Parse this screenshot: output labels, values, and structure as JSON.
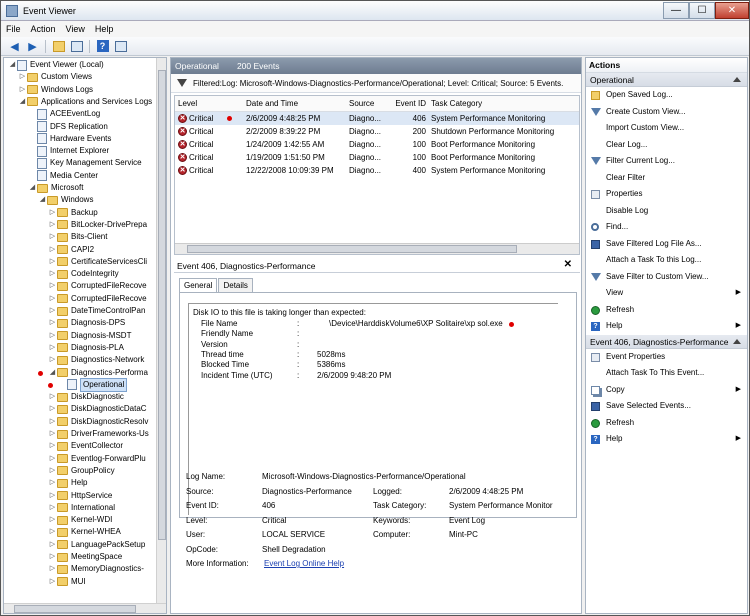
{
  "window": {
    "title": "Event Viewer",
    "min": "—",
    "max": "☐",
    "close": "✕"
  },
  "menu": [
    "File",
    "Action",
    "View",
    "Help"
  ],
  "toolbar": {
    "back": "◀",
    "forward": "▶",
    "help": "?"
  },
  "tree": [
    {
      "label": "Event Viewer (Local)",
      "depth": 0,
      "expanded": true,
      "icon": "viewer-icon"
    },
    {
      "label": "Custom Views",
      "depth": 1,
      "expanded": false,
      "icon": "folder-icon"
    },
    {
      "label": "Windows Logs",
      "depth": 1,
      "expanded": false,
      "icon": "folder-icon"
    },
    {
      "label": "Applications and Services Logs",
      "depth": 1,
      "expanded": true,
      "icon": "folder-icon"
    },
    {
      "label": "ACEEventLog",
      "depth": 2,
      "icon": "log-icon"
    },
    {
      "label": "DFS Replication",
      "depth": 2,
      "icon": "log-icon"
    },
    {
      "label": "Hardware Events",
      "depth": 2,
      "icon": "log-icon"
    },
    {
      "label": "Internet Explorer",
      "depth": 2,
      "icon": "log-icon"
    },
    {
      "label": "Key Management Service",
      "depth": 2,
      "icon": "log-icon"
    },
    {
      "label": "Media Center",
      "depth": 2,
      "icon": "log-icon"
    },
    {
      "label": "Microsoft",
      "depth": 2,
      "expanded": true,
      "icon": "folder-icon"
    },
    {
      "label": "Windows",
      "depth": 3,
      "expanded": true,
      "icon": "folder-icon"
    },
    {
      "label": "Backup",
      "depth": 4,
      "expanded": false,
      "icon": "folder-icon"
    },
    {
      "label": "BitLocker-DrivePrepa",
      "depth": 4,
      "expanded": false,
      "icon": "folder-icon"
    },
    {
      "label": "Bits-Client",
      "depth": 4,
      "expanded": false,
      "icon": "folder-icon"
    },
    {
      "label": "CAPI2",
      "depth": 4,
      "expanded": false,
      "icon": "folder-icon"
    },
    {
      "label": "CertificateServicesCli",
      "depth": 4,
      "expanded": false,
      "icon": "folder-icon"
    },
    {
      "label": "CodeIntegrity",
      "depth": 4,
      "expanded": false,
      "icon": "folder-icon"
    },
    {
      "label": "CorruptedFileRecove",
      "depth": 4,
      "expanded": false,
      "icon": "folder-icon"
    },
    {
      "label": "CorruptedFileRecove",
      "depth": 4,
      "expanded": false,
      "icon": "folder-icon"
    },
    {
      "label": "DateTimeControlPan",
      "depth": 4,
      "expanded": false,
      "icon": "folder-icon"
    },
    {
      "label": "Diagnosis-DPS",
      "depth": 4,
      "expanded": false,
      "icon": "folder-icon"
    },
    {
      "label": "Diagnosis-MSDT",
      "depth": 4,
      "expanded": false,
      "icon": "folder-icon"
    },
    {
      "label": "Diagnosis-PLA",
      "depth": 4,
      "expanded": false,
      "icon": "folder-icon"
    },
    {
      "label": "Diagnostics-Network",
      "depth": 4,
      "expanded": false,
      "icon": "folder-icon"
    },
    {
      "label": "Diagnostics-Performa",
      "depth": 4,
      "expanded": true,
      "icon": "folder-icon",
      "mark": true
    },
    {
      "label": "Operational",
      "depth": 5,
      "icon": "log-icon",
      "selected": true,
      "mark": true
    },
    {
      "label": "DiskDiagnostic",
      "depth": 4,
      "expanded": false,
      "icon": "folder-icon"
    },
    {
      "label": "DiskDiagnosticDataC",
      "depth": 4,
      "expanded": false,
      "icon": "folder-icon"
    },
    {
      "label": "DiskDiagnosticResolv",
      "depth": 4,
      "expanded": false,
      "icon": "folder-icon"
    },
    {
      "label": "DriverFrameworks-Us",
      "depth": 4,
      "expanded": false,
      "icon": "folder-icon"
    },
    {
      "label": "EventCollector",
      "depth": 4,
      "expanded": false,
      "icon": "folder-icon"
    },
    {
      "label": "Eventlog-ForwardPlu",
      "depth": 4,
      "expanded": false,
      "icon": "folder-icon"
    },
    {
      "label": "GroupPolicy",
      "depth": 4,
      "expanded": false,
      "icon": "folder-icon"
    },
    {
      "label": "Help",
      "depth": 4,
      "expanded": false,
      "icon": "folder-icon"
    },
    {
      "label": "HttpService",
      "depth": 4,
      "expanded": false,
      "icon": "folder-icon"
    },
    {
      "label": "International",
      "depth": 4,
      "expanded": false,
      "icon": "folder-icon"
    },
    {
      "label": "Kernel-WDI",
      "depth": 4,
      "expanded": false,
      "icon": "folder-icon"
    },
    {
      "label": "Kernel-WHEA",
      "depth": 4,
      "expanded": false,
      "icon": "folder-icon"
    },
    {
      "label": "LanguagePackSetup",
      "depth": 4,
      "expanded": false,
      "icon": "folder-icon"
    },
    {
      "label": "MeetingSpace",
      "depth": 4,
      "expanded": false,
      "icon": "folder-icon"
    },
    {
      "label": "MemoryDiagnostics-",
      "depth": 4,
      "expanded": false,
      "icon": "folder-icon"
    },
    {
      "label": "MUI",
      "depth": 4,
      "expanded": false,
      "icon": "folder-icon"
    }
  ],
  "center": {
    "log_name": "Operational",
    "event_count": "200 Events",
    "filter_text": "Filtered:Log: Microsoft-Windows-Diagnostics-Performance/Operational; Level: Critical; Source:  5 Events.",
    "columns": [
      "Level",
      "Date and Time",
      "Source",
      "Event ID",
      "Task Category"
    ],
    "rows": [
      {
        "level": "Critical",
        "date": "2/6/2009 4:48:25 PM",
        "source": "Diagno...",
        "id": "406",
        "task": "System Performance Monitoring",
        "selected": true,
        "mark": true
      },
      {
        "level": "Critical",
        "date": "2/2/2009 8:39:22 PM",
        "source": "Diagno...",
        "id": "200",
        "task": "Shutdown Performance Monitoring"
      },
      {
        "level": "Critical",
        "date": "1/24/2009 1:42:55 AM",
        "source": "Diagno...",
        "id": "100",
        "task": "Boot Performance Monitoring"
      },
      {
        "level": "Critical",
        "date": "1/19/2009 1:51:50 PM",
        "source": "Diagno...",
        "id": "100",
        "task": "Boot Performance Monitoring"
      },
      {
        "level": "Critical",
        "date": "12/22/2008 10:09:39 PM",
        "source": "Diagno...",
        "id": "400",
        "task": "System Performance Monitoring"
      }
    ]
  },
  "detail": {
    "title": "Event 406, Diagnostics-Performance",
    "close": "✕",
    "tabs": [
      "General",
      "Details"
    ],
    "message_head": "Disk IO to this file is taking longer than expected:",
    "fields": [
      {
        "k": "File Name",
        "v": "\\Device\\HarddiskVolume6\\XP Solitaire\\xp sol.exe",
        "mark": true
      },
      {
        "k": "Friendly Name",
        "v": ""
      },
      {
        "k": "Version",
        "v": ""
      },
      {
        "k": "Thread time",
        "v": "5028ms"
      },
      {
        "k": "Blocked Time",
        "v": "5386ms"
      },
      {
        "k": "Incident Time (UTC)",
        "v": "2/6/2009 9:48:20 PM"
      }
    ],
    "colon": ":",
    "props": {
      "log_name_k": "Log Name:",
      "log_name_v": "Microsoft-Windows-Diagnostics-Performance/Operational",
      "source_k": "Source:",
      "source_v": "Diagnostics-Performance",
      "logged_k": "Logged:",
      "logged_v": "2/6/2009 4:48:25 PM",
      "eventid_k": "Event ID:",
      "eventid_v": "406",
      "task_k": "Task Category:",
      "task_v": "System Performance Monitor",
      "level_k": "Level:",
      "level_v": "Critical",
      "keywords_k": "Keywords:",
      "keywords_v": "Event Log",
      "user_k": "User:",
      "user_v": "LOCAL SERVICE",
      "computer_k": "Computer:",
      "computer_v": "Mint-PC",
      "opcode_k": "OpCode:",
      "opcode_v": "Shell Degradation",
      "more_k": "More Information:",
      "more_v": "Event Log Online Help"
    }
  },
  "actions": {
    "title": "Actions",
    "section1": "Operational",
    "items1": [
      {
        "label": "Open Saved Log...",
        "icon": "open-folder-icon"
      },
      {
        "label": "Create Custom View...",
        "icon": "filter-icon"
      },
      {
        "label": "Import Custom View...",
        "icon": "none"
      },
      {
        "label": "Clear Log...",
        "icon": "none"
      },
      {
        "label": "Filter Current Log...",
        "icon": "filter-icon"
      },
      {
        "label": "Clear Filter",
        "icon": "none"
      },
      {
        "label": "Properties",
        "icon": "properties-icon"
      },
      {
        "label": "Disable Log",
        "icon": "none"
      },
      {
        "label": "Find...",
        "icon": "find-icon"
      },
      {
        "label": "Save Filtered Log File As...",
        "icon": "save-icon"
      },
      {
        "label": "Attach a Task To this Log...",
        "icon": "none"
      },
      {
        "label": "Save Filter to Custom View...",
        "icon": "filter-icon"
      },
      {
        "label": "View",
        "icon": "none",
        "submenu": true
      },
      {
        "label": "Refresh",
        "icon": "refresh-icon"
      },
      {
        "label": "Help",
        "icon": "help-icon",
        "submenu": true
      }
    ],
    "section2": "Event 406, Diagnostics-Performance",
    "items2": [
      {
        "label": "Event Properties",
        "icon": "properties-icon"
      },
      {
        "label": "Attach Task To This Event...",
        "icon": "none"
      },
      {
        "label": "Copy",
        "icon": "copy-icon",
        "submenu": true
      },
      {
        "label": "Save Selected Events...",
        "icon": "save-icon"
      },
      {
        "label": "Refresh",
        "icon": "refresh-icon"
      },
      {
        "label": "Help",
        "icon": "help-icon",
        "submenu": true
      }
    ],
    "submenu_glyph": "▶"
  }
}
